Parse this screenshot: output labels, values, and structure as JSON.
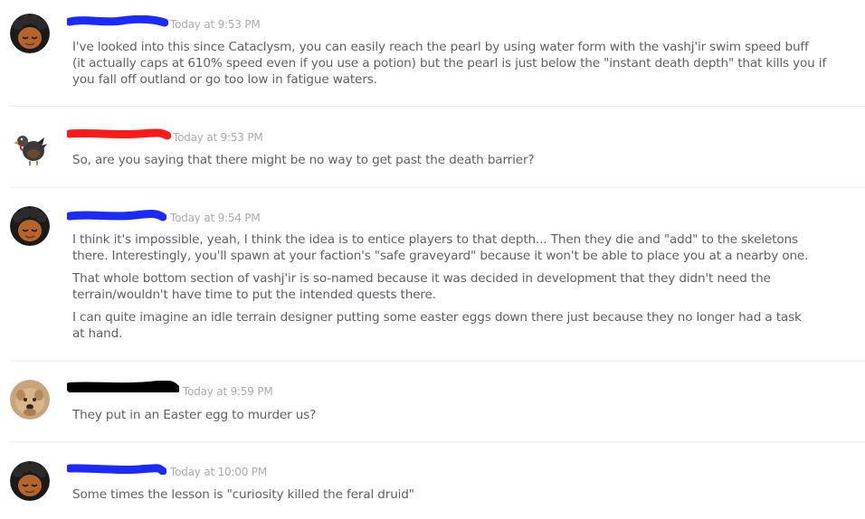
{
  "messages": [
    {
      "timestamp": "Today at 9:53 PM",
      "avatar": "curly-hair-avatar-icon",
      "lines": [
        "I've looked into this since Cataclysm, you can easily reach the pearl by using water form with the vashj'ir swim speed buff",
        "(it actually caps at 610% speed even if you use a potion) but the pearl is just below the \"instant death depth\" that kills you if",
        "you fall off outland or go too low in fatigue waters."
      ]
    },
    {
      "timestamp": "Today at 9:53 PM",
      "avatar": "turkey-avatar-icon",
      "lines": [
        "So, are you saying that there might be no way to get past the death barrier?"
      ]
    },
    {
      "timestamp": "Today at 9:54 PM",
      "avatar": "curly-hair-avatar-icon",
      "lines": [
        "I think it's impossible, yeah, I think the idea is to entice players to that depth... Then they  die and \"add\" to the skeletons",
        "there. Interestingly, you'll spawn at your faction's \"safe graveyard\" because it won't be able to place you at a nearby one.",
        "That whole bottom section of vashj'ir is so-named because it was decided in development that they didn't need the",
        "terrain/wouldn't have time to put the intended quests there.",
        "I can quite imagine an idle terrain designer putting some easter eggs down there just because they no longer had a task",
        "at hand."
      ]
    },
    {
      "timestamp": "Today at 9:59 PM",
      "avatar": "dog-photo-avatar-icon",
      "lines": [
        "They put in an Easter egg to murder us?"
      ]
    },
    {
      "timestamp": "Today at 10:00 PM",
      "avatar": "curly-hair-avatar-icon",
      "lines": [
        "Some times the lesson is \"curiosity killed the feral druid\""
      ]
    }
  ],
  "colors": {
    "redaction_blue": "#1b2bff",
    "redaction_red": "#ff1a1a",
    "redaction_black": "#000000",
    "timestamp": "#a8abaf",
    "message_text": "#5c6166",
    "divider": "#eceeef"
  }
}
